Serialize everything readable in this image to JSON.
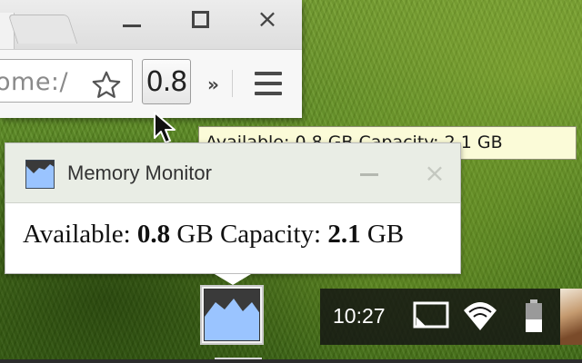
{
  "browser": {
    "url_partial": "ome:/",
    "extension_badge": "0.8",
    "overflow_label": "»"
  },
  "window_controls": {
    "close_glyph": "×"
  },
  "tooltip": {
    "text": "Available: 0.8 GB Capacity: 2.1 GB"
  },
  "popup": {
    "title": "Memory Monitor",
    "close_glyph": "×",
    "available_label": "Available:",
    "available_value": "0.8",
    "available_unit": "GB",
    "capacity_label": "Capacity:",
    "capacity_value": "2.1",
    "capacity_unit": "GB"
  },
  "tray": {
    "time": "10:27",
    "icons": [
      "screen-icon",
      "wifi-icon",
      "battery-icon",
      "avatar"
    ],
    "battery_level": 0.4
  },
  "colors": {
    "monitor_icon_fill": "#9ac4ff",
    "monitor_icon_dark": "#3a3a3a",
    "tooltip_bg": "#fbfbd8",
    "popup_header_bg": "#e9ede5",
    "tray_bg": "#141414"
  }
}
